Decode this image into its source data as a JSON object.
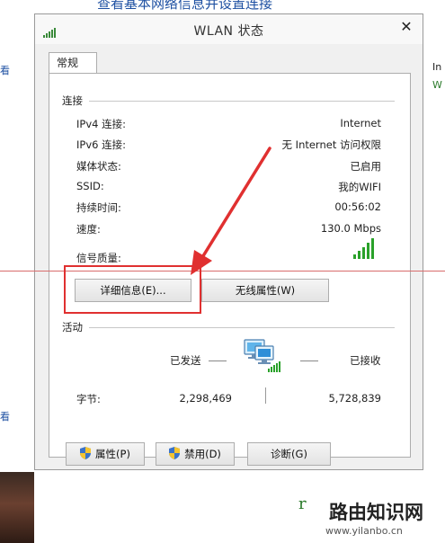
{
  "background": {
    "top_link": "查看基本网络信息并设置连接",
    "right_fragment_1": "In",
    "right_fragment_2": "W",
    "left_fragment_1": "看",
    "left_fragment_2": "看"
  },
  "window": {
    "title": "WLAN 状态",
    "close_glyph": "✕",
    "tab": "常规"
  },
  "connection": {
    "section": "连接",
    "rows": [
      {
        "label": "IPv4 连接:",
        "value": "Internet"
      },
      {
        "label": "IPv6 连接:",
        "value": "无 Internet 访问权限"
      },
      {
        "label": "媒体状态:",
        "value": "已启用"
      },
      {
        "label": "SSID:",
        "value": "我的WIFI"
      },
      {
        "label": "持续时间:",
        "value": "00:56:02"
      },
      {
        "label": "速度:",
        "value": "130.0 Mbps"
      }
    ],
    "signal_label": "信号质量:",
    "signal_level": 5,
    "details_button": "详细信息(E)...",
    "wireless_props_button": "无线属性(W)"
  },
  "activity": {
    "section": "活动",
    "sent_label": "已发送",
    "received_label": "已接收",
    "bytes_label": "字节:",
    "bytes_sent": "2,298,469",
    "bytes_received": "5,728,839"
  },
  "buttons": {
    "properties": "属性(P)",
    "disable": "禁用(D)",
    "diagnose": "诊断(G)"
  },
  "watermark": {
    "title": "路由知识网",
    "url": "www.yilanbo.cn",
    "green": "r"
  },
  "colors": {
    "annotation_red": "#e03030",
    "signal_green": "#2aa12a"
  }
}
